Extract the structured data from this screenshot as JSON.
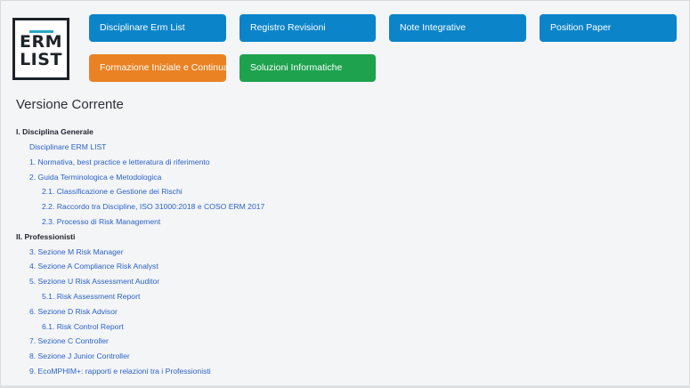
{
  "logo": {
    "lines": [
      "ERM",
      "LIST"
    ],
    "accent": "#2aa6c4"
  },
  "nav": {
    "buttons": [
      {
        "label": "Disciplinare Erm List",
        "color": "#0c84c9"
      },
      {
        "label": "Registro Revisioni",
        "color": "#0c84c9"
      },
      {
        "label": "Note Integrative",
        "color": "#0c84c9"
      },
      {
        "label": "Position Paper",
        "color": "#0c84c9"
      },
      {
        "label": "Formazione Iniziale e Continua",
        "color": "#ea8224"
      },
      {
        "label": "Soluzioni Informatiche",
        "color": "#1ea24e"
      }
    ]
  },
  "page": {
    "title": "Versione Corrente"
  },
  "toc": {
    "items": [
      {
        "text": "I. Disciplina Generale",
        "level": 0
      },
      {
        "text": "Disciplinare ERM LIST",
        "level": 1
      },
      {
        "text": "1. Normativa, best practice e letteratura di riferimento",
        "level": 1
      },
      {
        "text": "2. Guida Terminologica e Metodologica",
        "level": 1
      },
      {
        "text": "2.1. Classificazione e Gestione dei Rischi",
        "level": 2
      },
      {
        "text": "2.2. Raccordo tra Discipline, ISO 31000:2018 e COSO ERM 2017",
        "level": 2
      },
      {
        "text": "2.3. Processo di Risk Management",
        "level": 2
      },
      {
        "text": "II. Professionisti",
        "level": 0
      },
      {
        "text": "3. Sezione M Risk Manager",
        "level": 1
      },
      {
        "text": "4. Sezione A Compliance Risk Analyst",
        "level": 1
      },
      {
        "text": "5. Sezione U Risk Assessment Auditor",
        "level": 1
      },
      {
        "text": "5.1. Risk Assessment Report",
        "level": 2
      },
      {
        "text": "6. Sezione D Risk Advisor",
        "level": 1
      },
      {
        "text": "6.1. Risk Control Report",
        "level": 2
      },
      {
        "text": "7. Sezione C Controller",
        "level": 1
      },
      {
        "text": "8. Sezione J Junior Controller",
        "level": 1
      },
      {
        "text": "9. EcoMPHIM+: rapporti e relazioni tra i Professionisti",
        "level": 1
      }
    ]
  }
}
